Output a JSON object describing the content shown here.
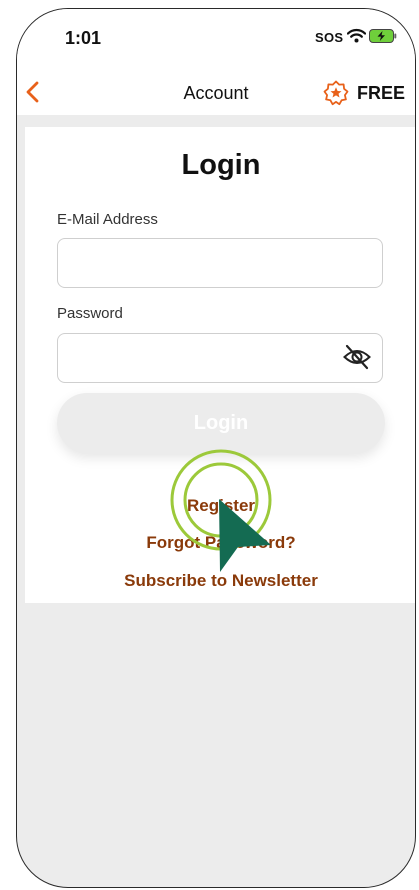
{
  "status_bar": {
    "time": "1:01",
    "sos": "SOS"
  },
  "nav": {
    "title": "Account",
    "free_label": "FREE"
  },
  "login_card": {
    "title": "Login",
    "email": {
      "label": "E-Mail Address",
      "value": "",
      "placeholder": ""
    },
    "password": {
      "label": "Password",
      "value": "",
      "placeholder": ""
    },
    "login_button": "Login",
    "links": {
      "register": "Register",
      "forgot_password": "Forgot Password?",
      "newsletter": "Subscribe to Newsletter"
    }
  },
  "colors": {
    "accent": "#e8611a",
    "link": "#8a3a0a",
    "background": "#ececec",
    "tap_ring": "#9cc93a",
    "cursor": "#146b52"
  },
  "icons": {
    "back": "chevron-left-icon",
    "badge": "star-badge-icon",
    "eye": "eye-slash-icon",
    "wifi": "wifi-icon",
    "battery": "battery-charging-icon"
  }
}
